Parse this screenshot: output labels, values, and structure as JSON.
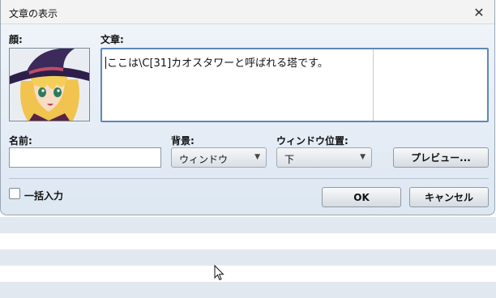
{
  "window": {
    "title": "文章の表示",
    "close_glyph": "✕"
  },
  "face": {
    "label": "顔:"
  },
  "text": {
    "label": "文章:",
    "value": "ここは\\C[31]カオスタワーと呼ばれる塔です。"
  },
  "name": {
    "label": "名前:",
    "value": ""
  },
  "background": {
    "label": "背景:",
    "selected": "ウィンドウ"
  },
  "window_position": {
    "label": "ウィンドウ位置:",
    "selected": "下"
  },
  "buttons": {
    "preview": "プレビュー...",
    "ok": "OK",
    "cancel": "キャンセル"
  },
  "batch_input": {
    "label": "一括入力",
    "checked": false
  },
  "icons": {
    "close": "close-icon",
    "dropdown": "chevron-down-icon",
    "cursor": "mouse-pointer-icon"
  },
  "colors": {
    "accent_border": "#5f87b5",
    "dialog_bg": "#e3ecf5",
    "hair": "#f2cf5c",
    "hat": "#3b2a5a"
  }
}
